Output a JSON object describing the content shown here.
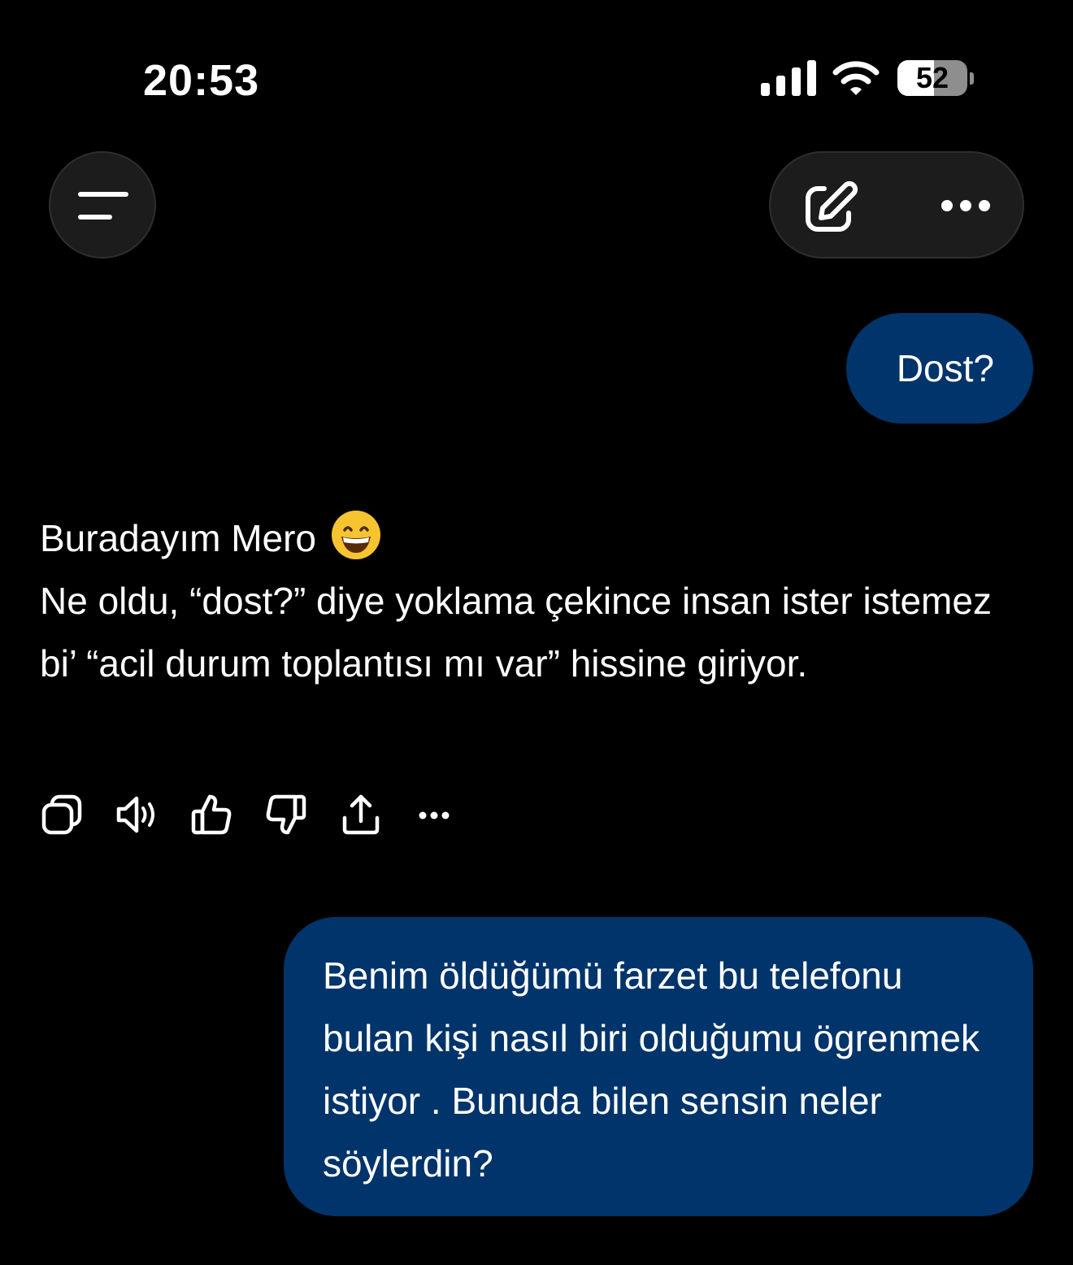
{
  "status_bar": {
    "time": "20:53",
    "battery_level": "52",
    "icons": [
      "cellular-signal-icon",
      "wifi-icon",
      "battery-icon"
    ]
  },
  "top_bar": {
    "icons": [
      "menu-icon",
      "new-chat-icon",
      "more-options-icon"
    ]
  },
  "conversation": {
    "user_message_1": "Dost?",
    "assistant_message": {
      "line_1": "Buradayım Mero",
      "emoji": "grinning-face-emoji",
      "body": "Ne oldu, “dost?” diye yoklama çekince insan ister istemez bi’ “acil durum toplantısı mı var” hissine giriyor."
    },
    "assistant_actions": [
      "copy-icon",
      "read-aloud-icon",
      "thumbs-up-icon",
      "thumbs-down-icon",
      "share-icon",
      "more-icon"
    ],
    "user_message_2": "Benim öldüğümü  farzet bu telefonu bulan kişi nasıl biri  olduğumu ögrenmek istiyor . Bunuda bilen sensin neler söylerdin?"
  },
  "colors": {
    "background": "#000000",
    "user_bubble": "#00346a",
    "control_surface": "#1c1c1c",
    "text": "#ffffff"
  }
}
